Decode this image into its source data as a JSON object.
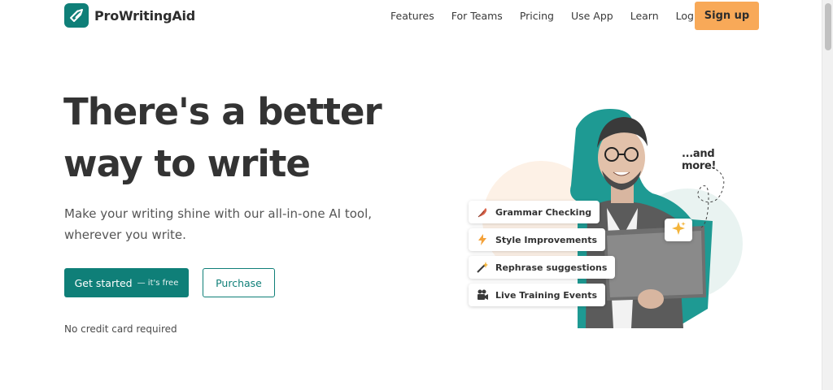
{
  "header": {
    "brand": "ProWritingAid",
    "nav": [
      "Features",
      "For Teams",
      "Pricing",
      "Use App",
      "Learn"
    ],
    "login": "Log in",
    "signup": "Sign up"
  },
  "hero": {
    "title_line1": "There's a better",
    "title_line2": "way to write",
    "subtitle_line1": "Make your writing shine with our all-in-one AI tool,",
    "subtitle_line2": "wherever you write.",
    "cta_primary": "Get started",
    "cta_primary_note": "— it's free",
    "cta_secondary": "Purchase",
    "note": "No credit card required"
  },
  "illustration": {
    "features": [
      {
        "label": "Grammar Checking",
        "icon": "feather-icon"
      },
      {
        "label": "Style Improvements",
        "icon": "lightning-icon"
      },
      {
        "label": "Rephrase suggestions",
        "icon": "magic-wand-icon"
      },
      {
        "label": "Live Training Events",
        "icon": "video-camera-icon"
      }
    ],
    "more": "...and more!",
    "badge_icon": "sparkle-icon"
  },
  "colors": {
    "brand_teal": "#0f7f78",
    "accent_orange": "#f8a958",
    "text_dark": "#333333"
  }
}
